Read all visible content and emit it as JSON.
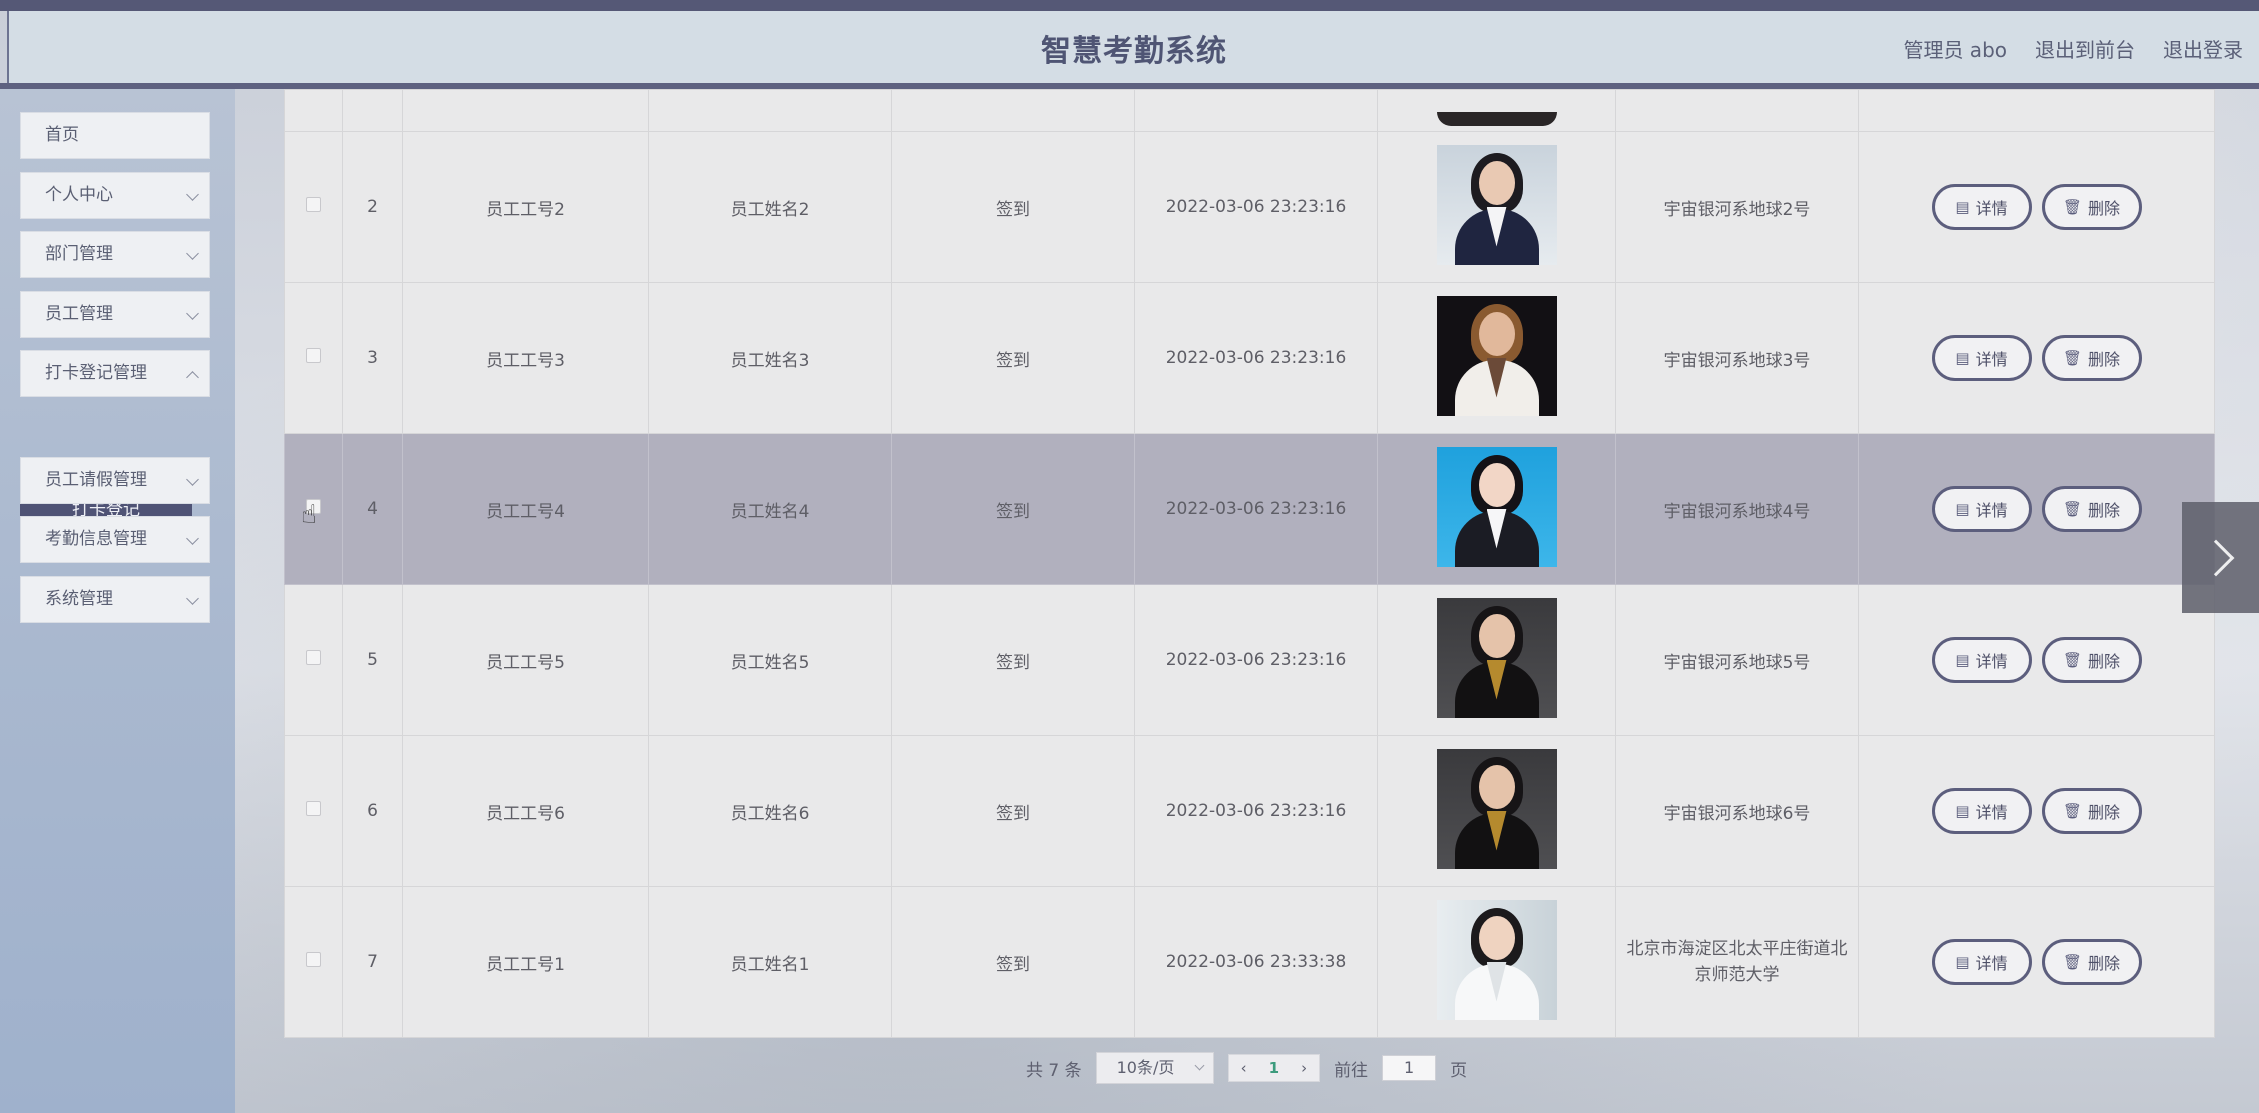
{
  "header": {
    "title": "智慧考勤系统",
    "user": "管理员 abo",
    "to_front": "退出到前台",
    "logout": "退出登录"
  },
  "sidebar": {
    "items": [
      {
        "label": "首页"
      },
      {
        "label": "个人中心"
      },
      {
        "label": "部门管理"
      },
      {
        "label": "员工管理"
      },
      {
        "label": "打卡登记管理"
      },
      {
        "label": "员工请假管理"
      },
      {
        "label": "考勤信息管理"
      },
      {
        "label": "系统管理"
      }
    ],
    "active_sub": "打卡登记"
  },
  "table": {
    "rows": [
      {
        "index": "2",
        "emp_id": "员工工号2",
        "emp_name": "员工姓名2",
        "type": "签到",
        "time": "2022-03-06 23:23:16",
        "addr": "宇宙银河系地球2号"
      },
      {
        "index": "3",
        "emp_id": "员工工号3",
        "emp_name": "员工姓名3",
        "type": "签到",
        "time": "2022-03-06 23:23:16",
        "addr": "宇宙银河系地球3号"
      },
      {
        "index": "4",
        "emp_id": "员工工号4",
        "emp_name": "员工姓名4",
        "type": "签到",
        "time": "2022-03-06 23:23:16",
        "addr": "宇宙银河系地球4号"
      },
      {
        "index": "5",
        "emp_id": "员工工号5",
        "emp_name": "员工姓名5",
        "type": "签到",
        "time": "2022-03-06 23:23:16",
        "addr": "宇宙银河系地球5号"
      },
      {
        "index": "6",
        "emp_id": "员工工号6",
        "emp_name": "员工姓名6",
        "type": "签到",
        "time": "2022-03-06 23:23:16",
        "addr": "宇宙银河系地球6号"
      },
      {
        "index": "7",
        "emp_id": "员工工号1",
        "emp_name": "员工姓名1",
        "type": "签到",
        "time": "2022-03-06 23:33:38",
        "addr": "北京市海淀区北太平庄街道北京师范大学"
      }
    ],
    "detail_label": "详情",
    "delete_label": "删除"
  },
  "pagination": {
    "total": "共 7 条",
    "page_size": "10条/页",
    "current_page": "1",
    "goto_prefix": "前往",
    "goto_value": "1",
    "goto_suffix": "页"
  },
  "colors": {
    "accent": "#5c5e7d",
    "header_bg": "#d4dde5",
    "active_submenu": "#4f5375",
    "hover_row": "#b1b0be"
  }
}
